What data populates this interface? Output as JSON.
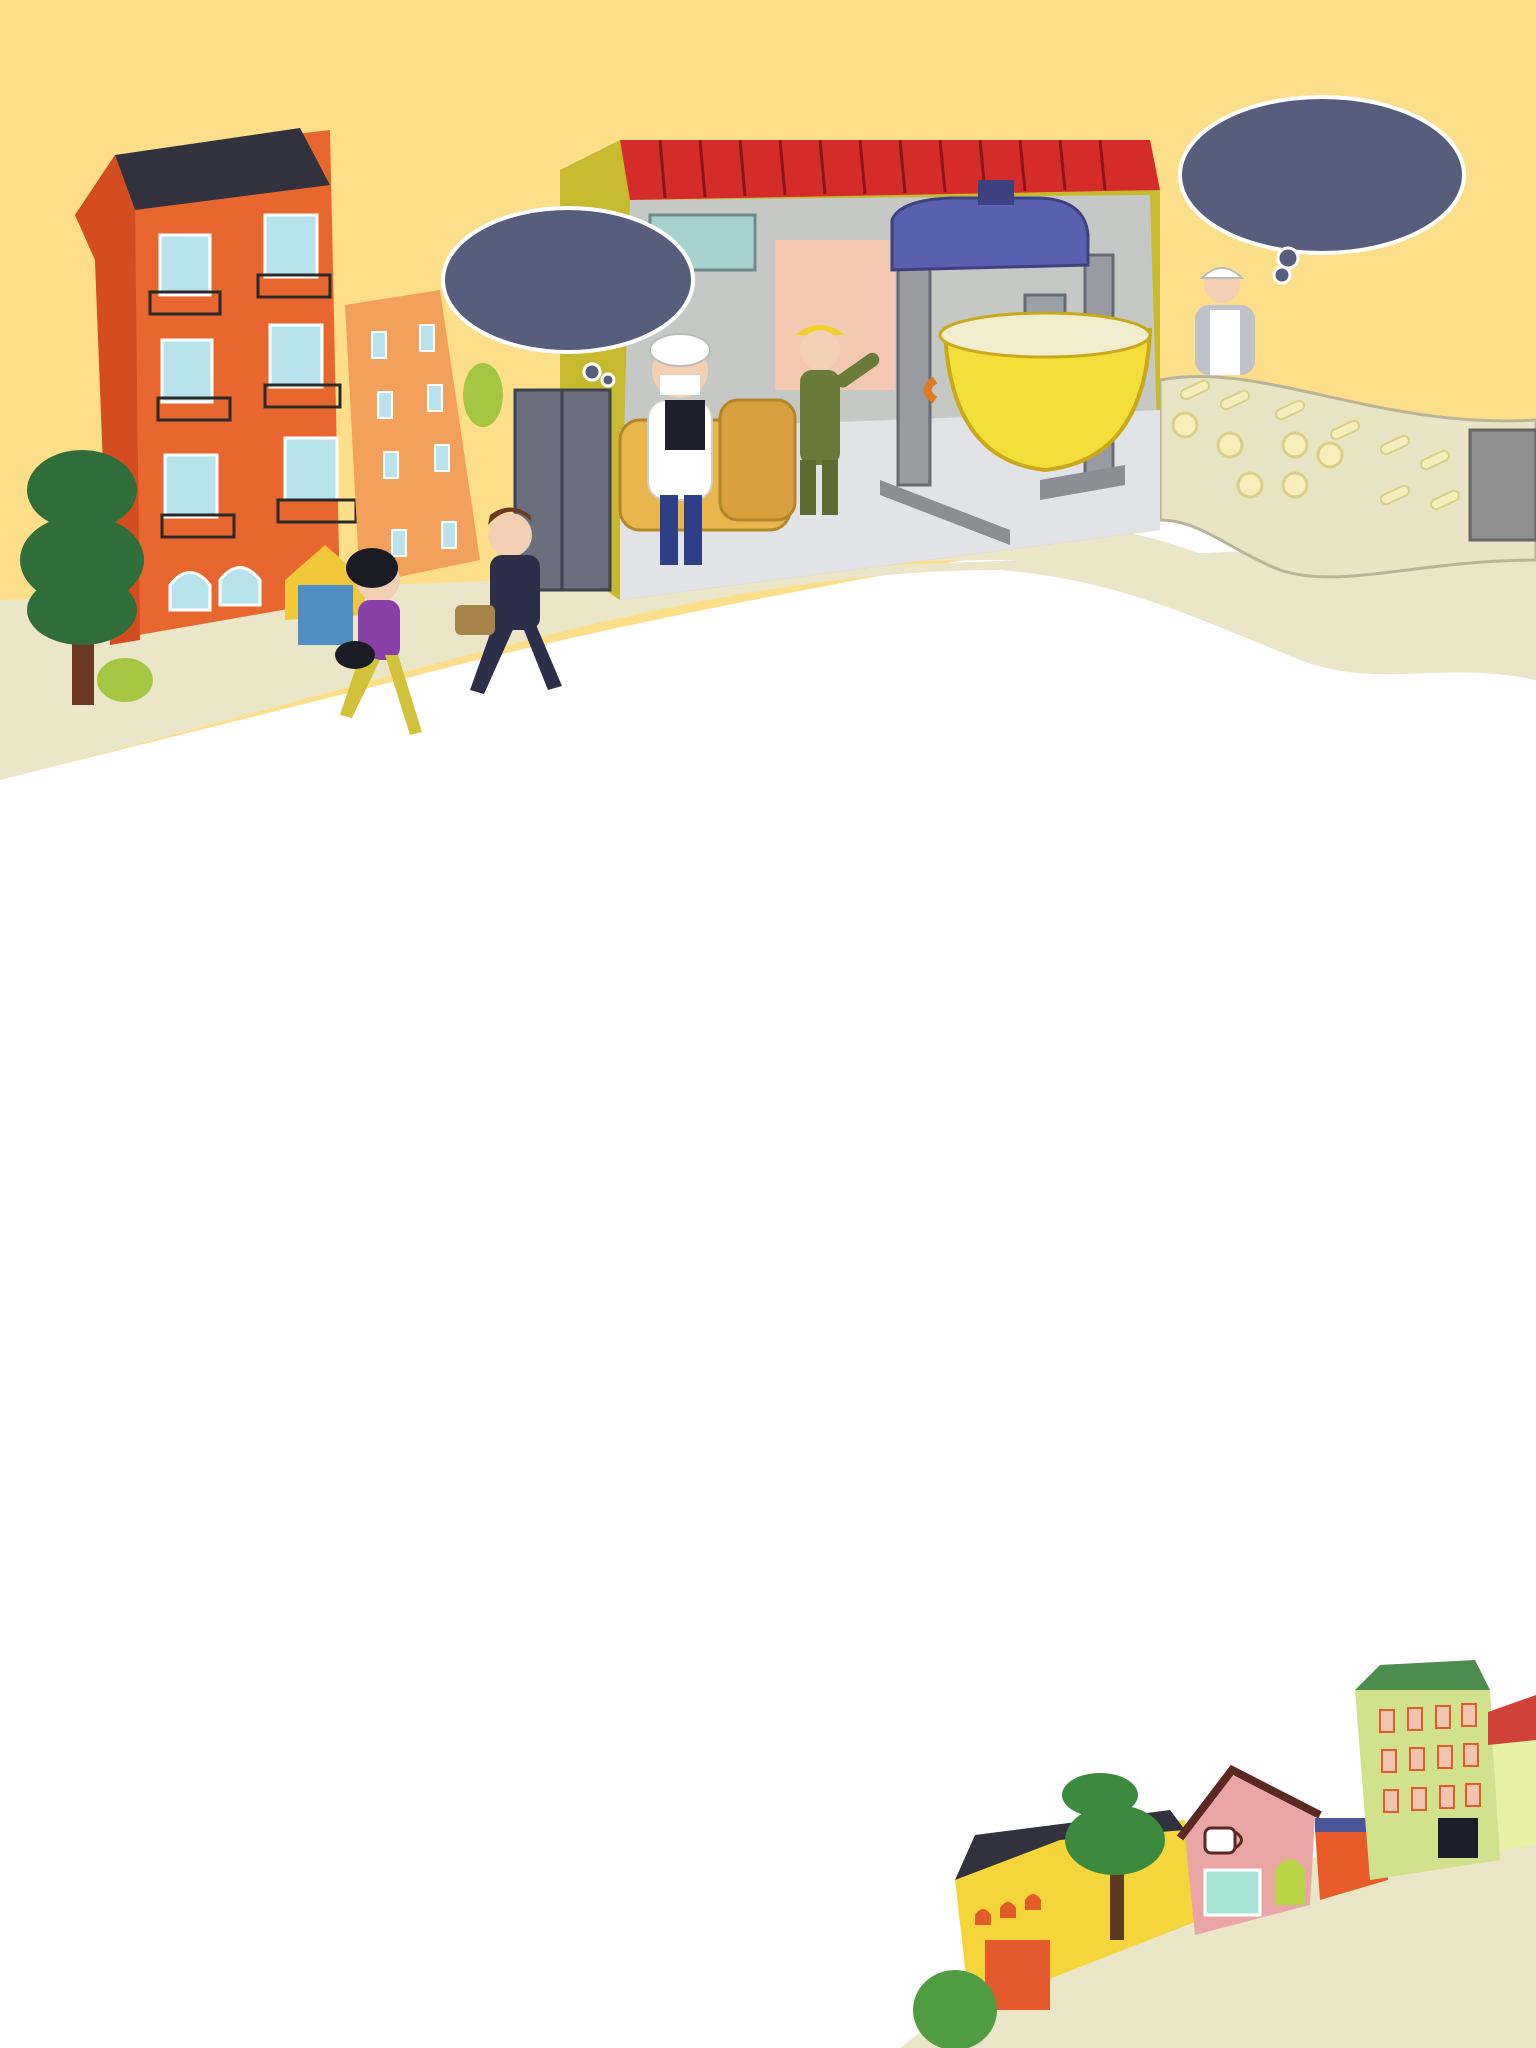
{
  "speech_bubbles": [
    {
      "id": "bubble-left",
      "text": ""
    },
    {
      "id": "bubble-right",
      "text": ""
    }
  ],
  "colors": {
    "sky": "#fddf8a",
    "ground": "#ebe6c8",
    "bubble": "#565d7d",
    "factory_roof": "#d52b2b",
    "factory_wall": "#c8ba2e",
    "building_orange": "#e8672e",
    "building_peach": "#f3a15a",
    "mixer_bowl": "#f4de3a",
    "mixer_head": "#5b5fb0"
  }
}
